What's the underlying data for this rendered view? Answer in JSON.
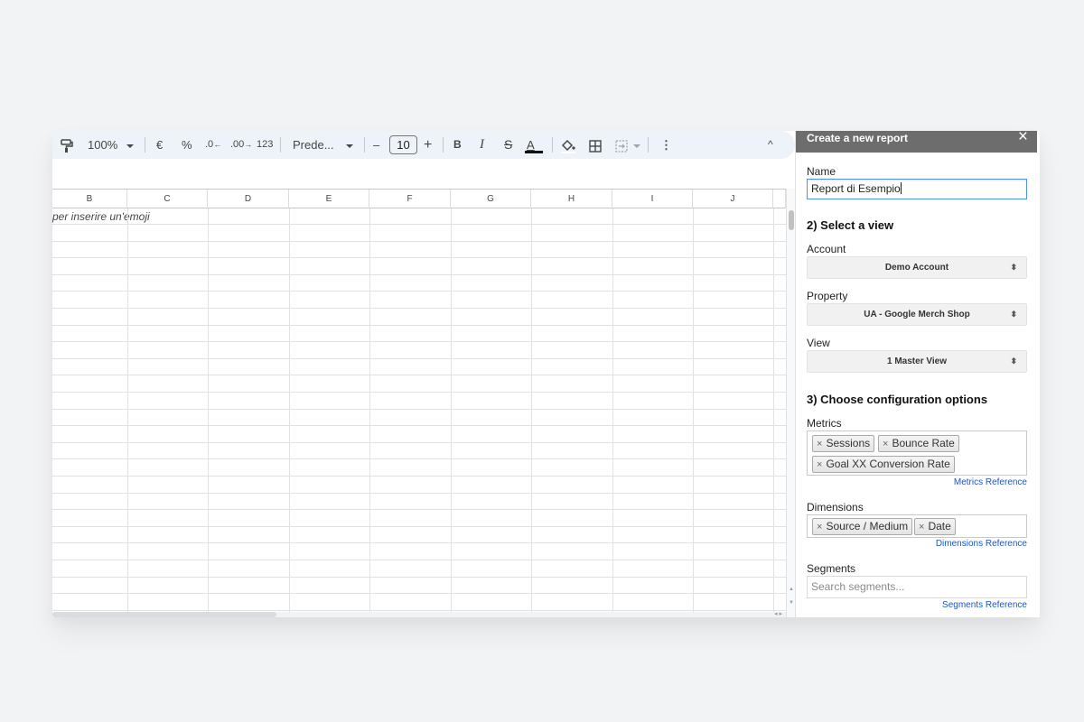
{
  "toolbar": {
    "zoom": "100%",
    "currency": "€",
    "percent": "%",
    "decrease_decimal": ".0",
    "increase_decimal": ".00",
    "number_format": "123",
    "font": "Prede...",
    "minus": "–",
    "font_size": "10",
    "plus": "+",
    "bold": "B",
    "italic": "I",
    "strike": "S",
    "text_color": "A",
    "more": "⋮",
    "collapse": "^"
  },
  "sheet": {
    "columns": [
      "B",
      "C",
      "D",
      "E",
      "F",
      "G",
      "H",
      "I",
      "J"
    ],
    "cell_b1": "per inserire un'emoji"
  },
  "sidebar": {
    "title": "Create a new report",
    "close": "×",
    "name_label": "Name",
    "name_value": "Report di Esempio",
    "section2": "2) Select a view",
    "account_label": "Account",
    "account_value": "Demo Account",
    "property_label": "Property",
    "property_value": "UA - Google Merch Shop",
    "view_label": "View",
    "view_value": "1 Master View",
    "section3": "3) Choose configuration options",
    "metrics_label": "Metrics",
    "metrics": [
      "Sessions",
      "Bounce Rate",
      "Goal XX Conversion Rate"
    ],
    "metrics_ref": "Metrics Reference",
    "dimensions_label": "Dimensions",
    "dimensions": [
      "Source / Medium",
      "Date"
    ],
    "dimensions_ref": "Dimensions Reference",
    "segments_label": "Segments",
    "segments_placeholder": "Search segments...",
    "segments_ref": "Segments Reference",
    "chip_remove": "×",
    "select_arrows": "⬍"
  },
  "colors": {
    "page_bg": "#f2f3f5",
    "toolbar_bg": "#eef2f9",
    "sidebar_header": "#6d6d6d",
    "link": "#1a56c8",
    "focus_border": "#4d90fe"
  }
}
